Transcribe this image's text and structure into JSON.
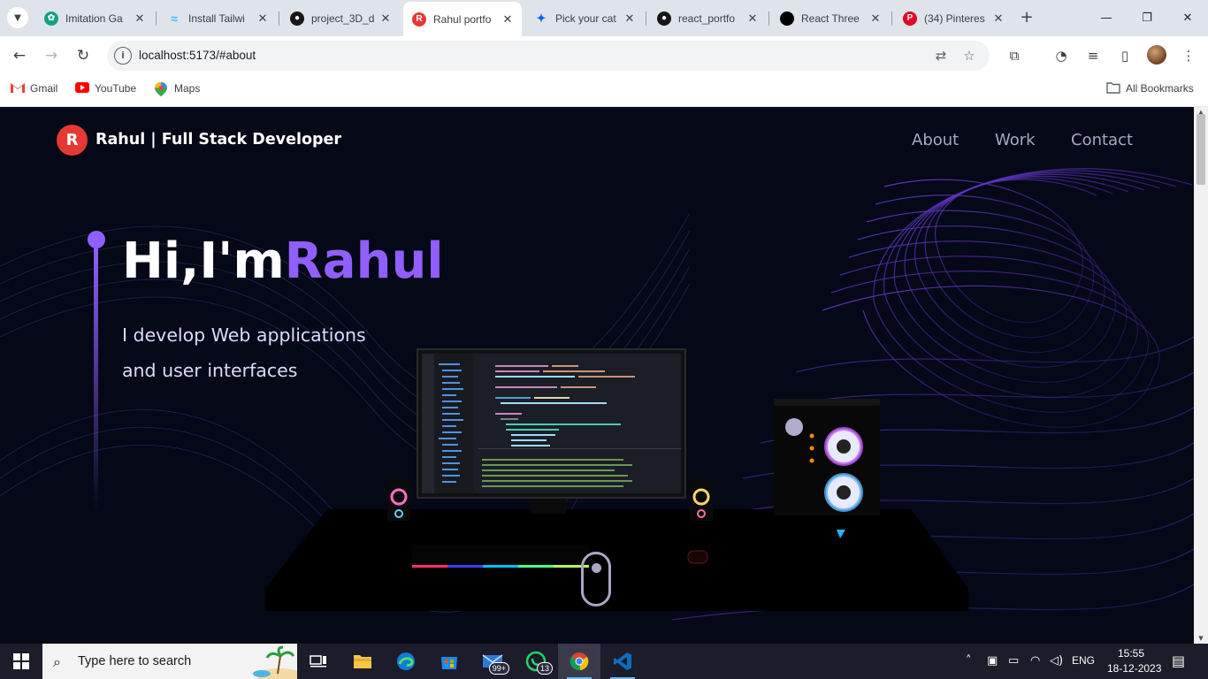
{
  "browser": {
    "tabs": [
      {
        "title": "Imitation Ga",
        "icon": "openai-icon",
        "color": "#10a37f"
      },
      {
        "title": "Install Tailwi",
        "icon": "tailwind-icon",
        "color": "#38bdf8"
      },
      {
        "title": "project_3D_d",
        "icon": "github-icon",
        "color": "#181717"
      },
      {
        "title": "Rahul portfo",
        "icon": "site-logo-icon",
        "color": "#e53935"
      },
      {
        "title": "Pick your cat",
        "icon": "dropbox-icon",
        "color": "#0061ff"
      },
      {
        "title": "react_portfo",
        "icon": "github-icon",
        "color": "#181717"
      },
      {
        "title": "React Three",
        "icon": "r3f-icon",
        "color": "#000000"
      },
      {
        "title": "(34) Pinteres",
        "icon": "pinterest-icon",
        "color": "#e60023"
      }
    ],
    "url": "localhost:5173/#about",
    "bookmarks": [
      {
        "label": "Gmail",
        "icon": "gmail-icon"
      },
      {
        "label": "YouTube",
        "icon": "youtube-icon"
      },
      {
        "label": "Maps",
        "icon": "maps-icon"
      }
    ],
    "all_bookmarks": "All Bookmarks"
  },
  "site": {
    "logo_letter": "R",
    "title": "Rahul  | Full Stack Developer",
    "nav": [
      "About",
      "Work",
      "Contact"
    ],
    "hero": {
      "greeting": "Hi,I'm",
      "name": "Rahul",
      "subtitle_line1": "I develop Web applications",
      "subtitle_line2": "and user interfaces"
    },
    "colors": {
      "accent": "#915eff",
      "background": "#050816",
      "nav_link": "#aaa6c3"
    }
  },
  "taskbar": {
    "search_placeholder": "Type here to search",
    "mail_badge": "99+",
    "whatsapp_badge": "13",
    "language": "ENG",
    "time": "15:55",
    "date": "18-12-2023"
  }
}
